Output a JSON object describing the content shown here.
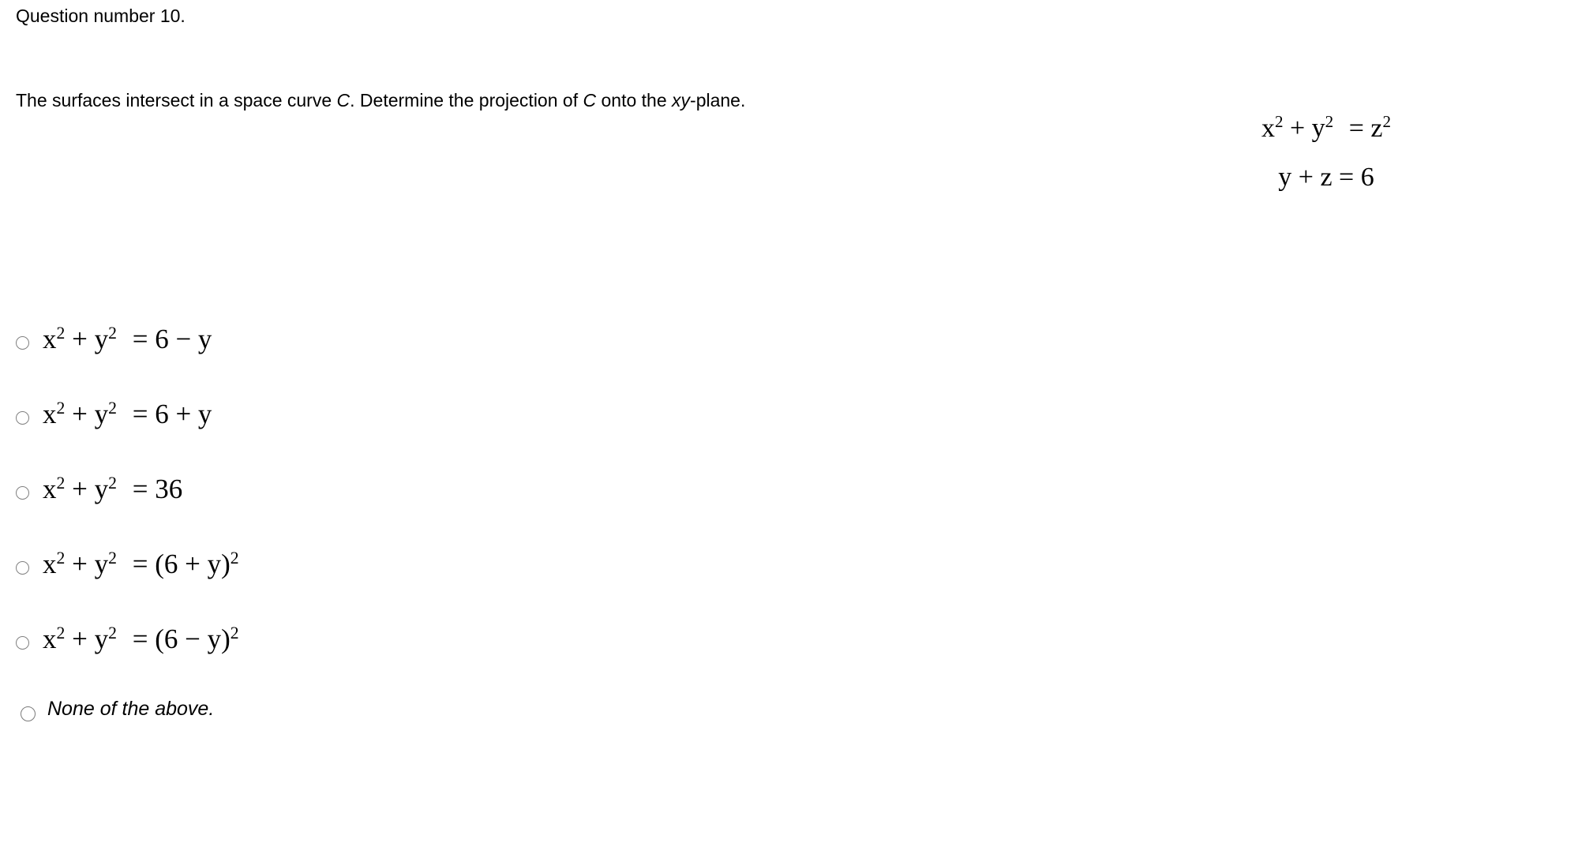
{
  "page": {
    "background_color": "#ffffff",
    "text_color": "#000000",
    "radio_border_color": "#808080"
  },
  "header": {
    "text": "Question number 10."
  },
  "prompt": {
    "part1": "The surfaces intersect in a space curve ",
    "curve_symbol": "C",
    "part2": ". Determine the projection of ",
    "curve_symbol2": "C",
    "part3": " onto the ",
    "plane_symbol": "xy",
    "part4": "-plane."
  },
  "given_equations": {
    "equation1": {
      "base1": "x",
      "exp1": "2",
      "op1": " + ",
      "base2": "y",
      "exp2": "2",
      "rel": " = ",
      "base3": "z",
      "exp3": "2"
    },
    "equation2": {
      "text": "y + z = 6"
    }
  },
  "options": [
    {
      "id": "option-a",
      "kind": "math",
      "lhs_base1": "x",
      "lhs_exp1": "2",
      "lhs_op": " + ",
      "lhs_base2": "y",
      "lhs_exp2": "2",
      "rel": " = ",
      "rhs": "6 − y",
      "plain_text": "x^2 + y^2 = 6 − y",
      "selected": false
    },
    {
      "id": "option-b",
      "kind": "math",
      "lhs_base1": "x",
      "lhs_exp1": "2",
      "lhs_op": " + ",
      "lhs_base2": "y",
      "lhs_exp2": "2",
      "rel": " = ",
      "rhs": "6 + y",
      "plain_text": "x^2 + y^2 = 6 + y",
      "selected": false
    },
    {
      "id": "option-c",
      "kind": "math",
      "lhs_base1": "x",
      "lhs_exp1": "2",
      "lhs_op": " + ",
      "lhs_base2": "y",
      "lhs_exp2": "2",
      "rel": " = ",
      "rhs": "36",
      "plain_text": "x^2 + y^2 = 36",
      "selected": false
    },
    {
      "id": "option-d",
      "kind": "math-power",
      "lhs_base1": "x",
      "lhs_exp1": "2",
      "lhs_op": " + ",
      "lhs_base2": "y",
      "lhs_exp2": "2",
      "rel": " = ",
      "rhs": "(6 + y)",
      "rhs_exp": "2",
      "plain_text": "x^2 + y^2 = (6 + y)^2",
      "selected": false
    },
    {
      "id": "option-e",
      "kind": "math-power",
      "lhs_base1": "x",
      "lhs_exp1": "2",
      "lhs_op": " + ",
      "lhs_base2": "y",
      "lhs_exp2": "2",
      "rel": " = ",
      "rhs": "(6 − y)",
      "rhs_exp": "2",
      "plain_text": "x^2 + y^2 = (6 − y)^2",
      "selected": false
    },
    {
      "id": "option-f",
      "kind": "text",
      "label": "None of the above.",
      "plain_text": "None of the above.",
      "selected": false
    }
  ]
}
